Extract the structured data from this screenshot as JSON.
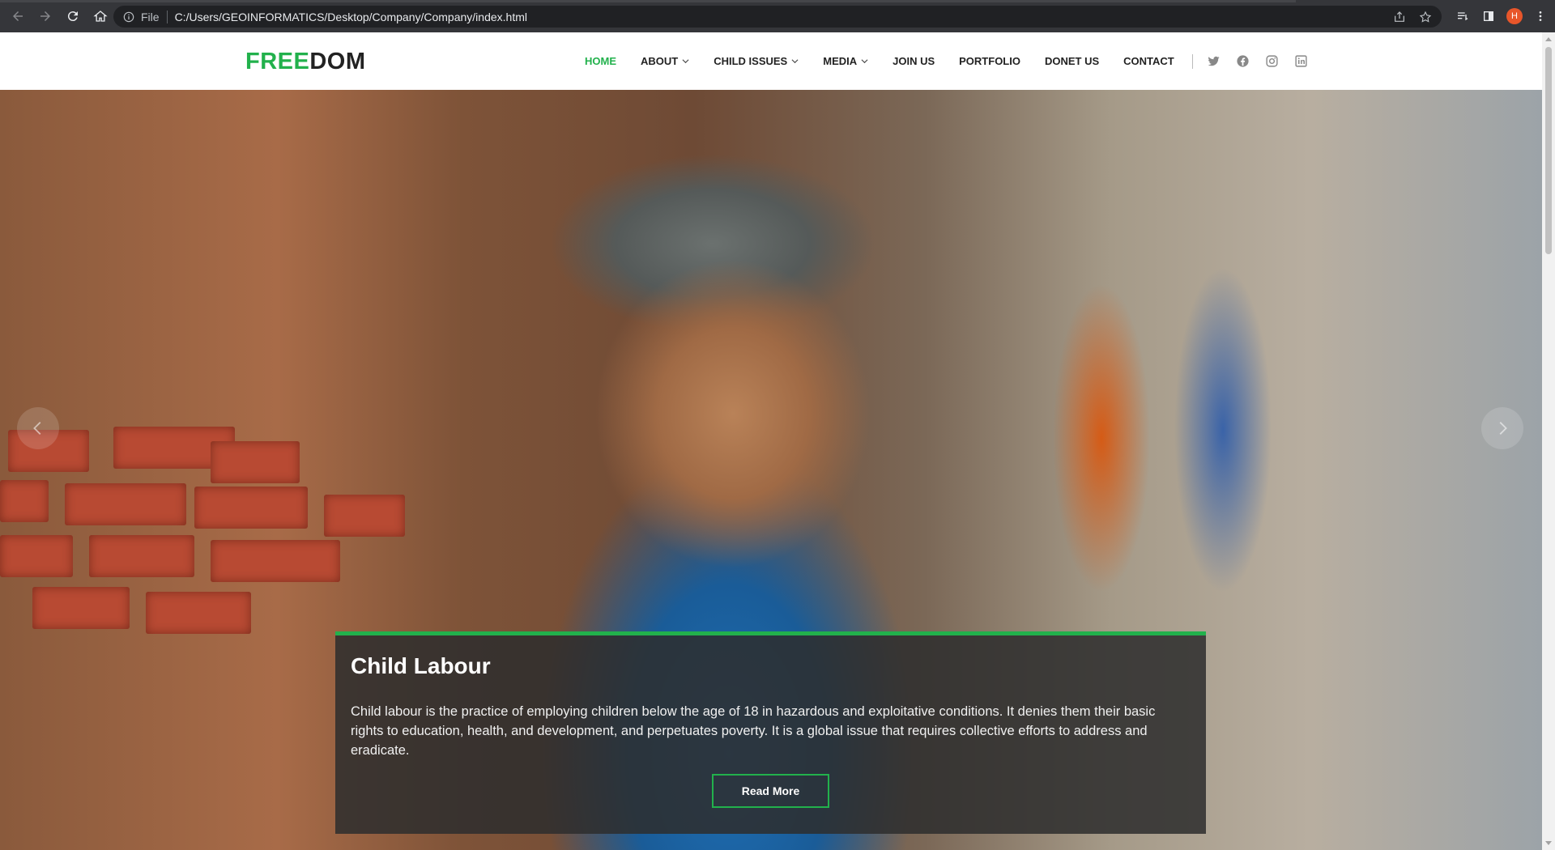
{
  "browser": {
    "scheme_label": "File",
    "url": "C:/Users/GEOINFORMATICS/Desktop/Company/Company/index.html",
    "profile_initial": "H"
  },
  "site": {
    "logo_part1": "FREE",
    "logo_part2": "DOM",
    "nav": [
      {
        "label": "HOME",
        "active": true
      },
      {
        "label": "ABOUT",
        "dropdown": true
      },
      {
        "label": "CHILD ISSUES",
        "dropdown": true
      },
      {
        "label": "MEDIA",
        "dropdown": true
      },
      {
        "label": "JOIN US"
      },
      {
        "label": "PORTFOLIO"
      },
      {
        "label": "DONET US"
      },
      {
        "label": "CONTACT"
      }
    ],
    "social": [
      "twitter-icon",
      "facebook-icon",
      "instagram-icon",
      "linkedin-icon"
    ]
  },
  "hero": {
    "title": "Child Labour",
    "text": "Child labour is the practice of employing children below the age of 18 in hazardous and exploitative conditions. It denies them their basic rights to education, health, and development, and perpetuates poverty. It is a global issue that requires collective efforts to address and eradicate.",
    "button_label": "Read More",
    "slide_count": 3,
    "active_slide": 1
  },
  "colors": {
    "accent": "#22b14c",
    "chrome_bg": "#35363a",
    "caption_bg": "#2d2d2d"
  }
}
